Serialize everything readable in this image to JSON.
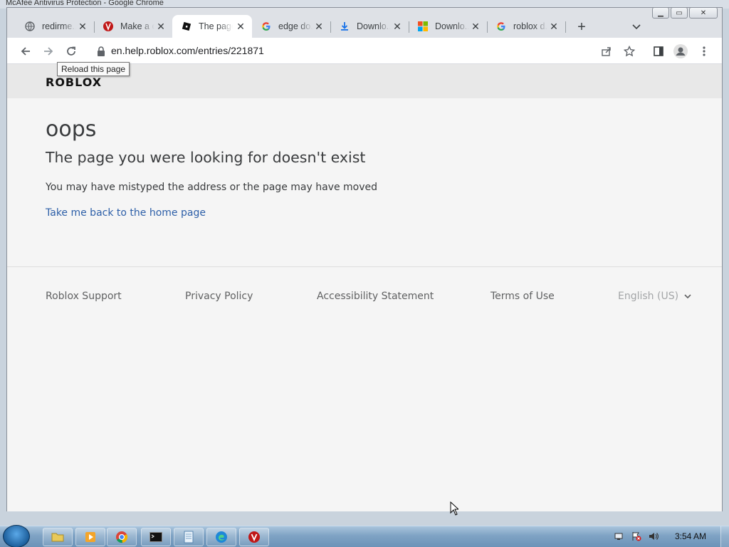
{
  "background_window": {
    "title": "McAfee Antivirus Protection - Google Chrome"
  },
  "tabs": [
    {
      "title": "redirme...",
      "icon": "globe-icon"
    },
    {
      "title": "Make a c...",
      "icon": "mcafee-icon"
    },
    {
      "title": "The page...",
      "icon": "roblox-icon",
      "active": true
    },
    {
      "title": "edge do...",
      "icon": "google-icon"
    },
    {
      "title": "Downlo...",
      "icon": "download-icon"
    },
    {
      "title": "Downlo...",
      "icon": "microsoft-icon"
    },
    {
      "title": "roblox d...",
      "icon": "google-icon"
    }
  ],
  "address_bar": {
    "url": "en.help.roblox.com/entries/221871"
  },
  "tooltip": "Reload this page",
  "site": {
    "logo": "ROBLOX"
  },
  "page": {
    "heading": "oops",
    "subheading": "The page you were looking for doesn't exist",
    "message": "You may have mistyped the address or the page may have moved",
    "home_link": "Take me back to the home page"
  },
  "footer": {
    "support": "Roblox Support",
    "privacy": "Privacy Policy",
    "accessibility": "Accessibility Statement",
    "terms": "Terms of Use",
    "language": "English (US)"
  },
  "taskbar": {
    "time": "3:54 AM"
  },
  "colors": {
    "link": "#2d5fa8",
    "page_bg": "#f5f5f5",
    "header_bg": "#e8e8e8"
  }
}
